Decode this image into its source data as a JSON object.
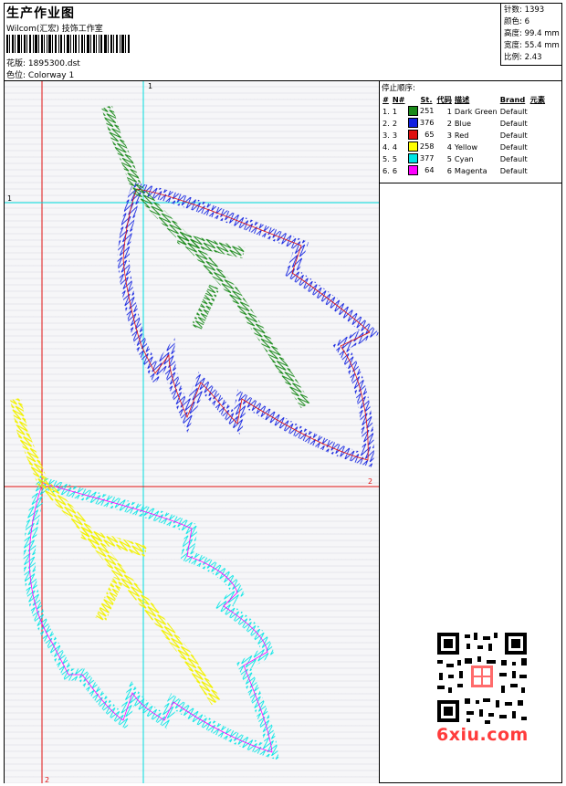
{
  "header": {
    "title": "生产作业图",
    "studio": "Wilcom(汇宏) 技饰工作室",
    "design_label": "花版:",
    "design_value": "1895300.dst",
    "colorway_label": "色位:",
    "colorway_value": "Colorway 1"
  },
  "specs": [
    {
      "label": "针数:",
      "value": "1393"
    },
    {
      "label": "颜色:",
      "value": "6"
    },
    {
      "label": "高度:",
      "value": "99.4 mm"
    },
    {
      "label": "宽度:",
      "value": "55.4 mm"
    },
    {
      "label": "比例:",
      "value": "2.43"
    }
  ],
  "stop_sequence": {
    "heading": "停止顺序:",
    "columns": [
      "#",
      "N#",
      "St.",
      "代码",
      "描述",
      "Brand",
      "元素"
    ],
    "rows": [
      {
        "idx": "1.",
        "n": "1",
        "color": "#1a8a1a",
        "st": "251",
        "code": "1",
        "desc": "Dark Green",
        "brand": "Default"
      },
      {
        "idx": "2.",
        "n": "2",
        "color": "#1020e0",
        "st": "376",
        "code": "2",
        "desc": "Blue",
        "brand": "Default"
      },
      {
        "idx": "3.",
        "n": "3",
        "color": "#e01010",
        "st": "65",
        "code": "3",
        "desc": "Red",
        "brand": "Default"
      },
      {
        "idx": "4.",
        "n": "4",
        "color": "#ffff00",
        "st": "258",
        "code": "4",
        "desc": "Yellow",
        "brand": "Default"
      },
      {
        "idx": "5.",
        "n": "5",
        "color": "#00e5e5",
        "st": "377",
        "code": "5",
        "desc": "Cyan",
        "brand": "Default"
      },
      {
        "idx": "6.",
        "n": "6",
        "color": "#ff00ff",
        "st": "64",
        "code": "6",
        "desc": "Magenta",
        "brand": "Default"
      }
    ]
  },
  "guides": {
    "h1": "1",
    "h2": "2",
    "v1": "1",
    "v2": "2"
  },
  "watermark": "6xiu.com"
}
